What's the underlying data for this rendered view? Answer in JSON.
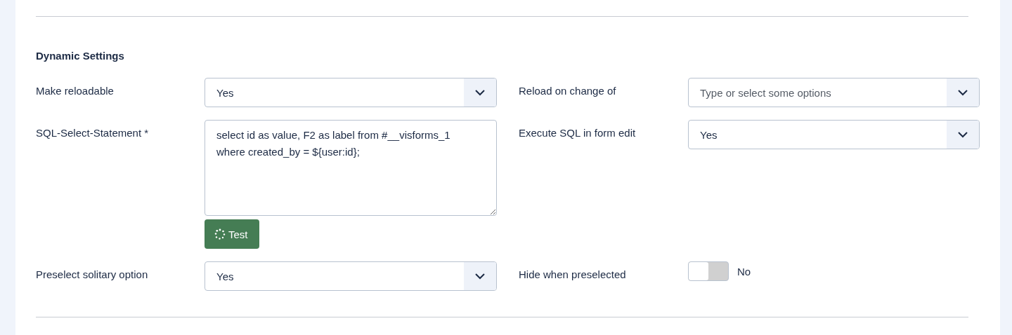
{
  "section_title": "Dynamic Settings",
  "rows": [
    {
      "left": {
        "label": "Make reloadable",
        "kind": "select",
        "value": "Yes"
      },
      "right": {
        "label": "Reload on change of",
        "kind": "select",
        "placeholder": "Type or select some options"
      }
    },
    {
      "left": {
        "label": "SQL-Select-Statement *",
        "kind": "textarea",
        "value": "select id as value, F2 as label from #__visforms_1\nwhere created_by = ${user:id};",
        "button": "Test"
      },
      "right": {
        "label": "Execute SQL in form edit",
        "kind": "select",
        "value": "Yes"
      }
    },
    {
      "left": {
        "label": "Preselect solitary option",
        "kind": "select",
        "value": "Yes"
      },
      "right": {
        "label": "Hide when preselected",
        "kind": "toggle",
        "on": false,
        "value": "No"
      }
    }
  ]
}
